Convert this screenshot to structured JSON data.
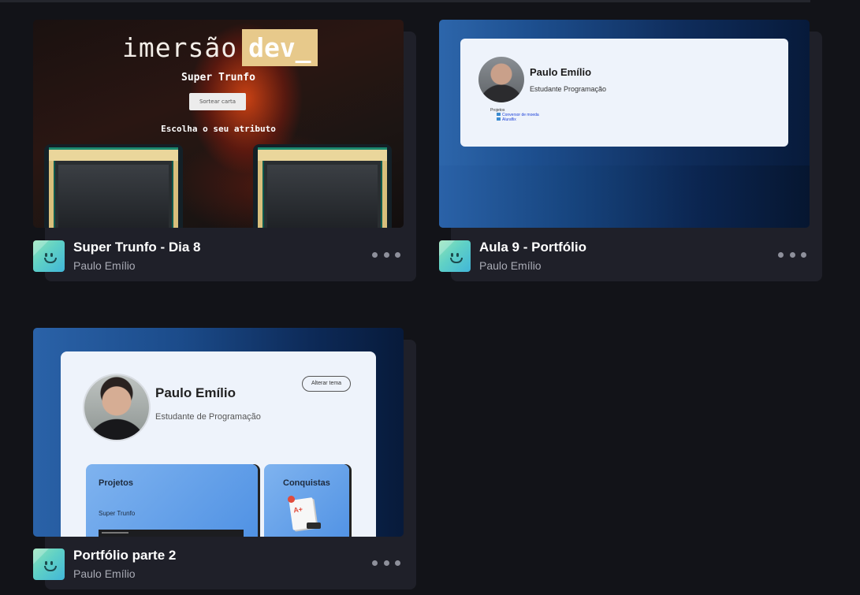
{
  "projects": [
    {
      "title": "Super Trunfo - Dia 8",
      "author": "Paulo Emílio",
      "preview": {
        "brand_word": "imersão",
        "brand_tag": "dev_",
        "heading": "Super Trunfo",
        "button": "Sortear carta",
        "prompt": "Escolha o seu atributo"
      }
    },
    {
      "title": "Aula 9 - Portfólio",
      "author": "Paulo Emílio",
      "preview": {
        "name": "Paulo Emílio",
        "role": "Estudante Programação",
        "projects_label": "Projetos",
        "links": [
          "Conversor de moeda",
          "Aluraflix"
        ]
      }
    },
    {
      "title": "Portfólio parte 2",
      "author": "Paulo Emílio",
      "preview": {
        "name": "Paulo Emílio",
        "role": "Estudante de Programação",
        "theme_button": "Alterar tema",
        "projects_heading": "Projetos",
        "project_item": "Super Trunfo",
        "achievements_heading": "Conquistas",
        "badge_grade": "A+"
      }
    }
  ],
  "colors": {
    "background": "#121318",
    "card": "#1f2029",
    "brand_gold": "#e7c98b"
  },
  "icons": {
    "avatar": "alura-smile-logo",
    "menu": "more-horizontal-icon"
  }
}
